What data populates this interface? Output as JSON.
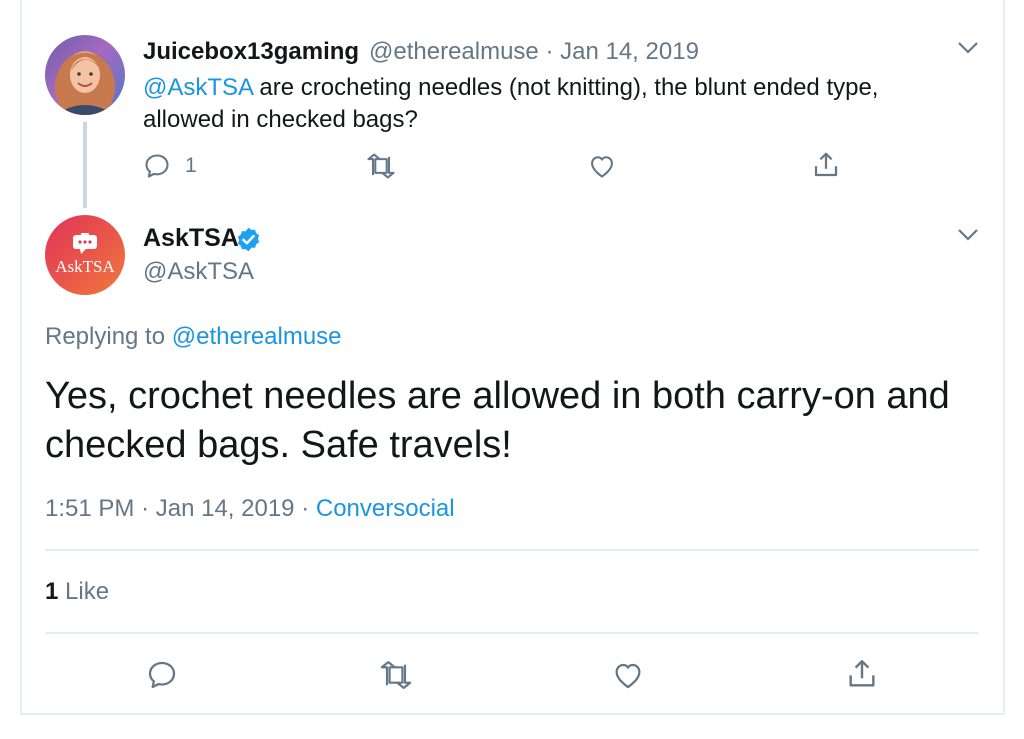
{
  "parent_tweet": {
    "display_name": "Juicebox13gaming",
    "handle": "@etherealmuse",
    "date": "Jan 14, 2019",
    "mention": "@AskTSA",
    "text_line1_rest": " are crocheting needles (not knitting), the blunt ended type,",
    "text_line2": "allowed in checked bags?",
    "reply_count": "1"
  },
  "reply_tweet": {
    "display_name": "AskTSA",
    "handle": "@AskTSA",
    "avatar_label": "AskTSA",
    "replying_to_label": "Replying to",
    "replying_to_handle": "@etherealmuse",
    "text_line1": "Yes, crochet needles are allowed in both carry-on and",
    "text_line2": "checked bags. Safe travels!",
    "time": "1:51 PM",
    "date": "Jan 14, 2019",
    "source": "Conversocial",
    "like_count": "1",
    "like_label": "Like"
  },
  "colors": {
    "link": "#1b95e0",
    "secondary_text": "#657786",
    "primary_text": "#14171a",
    "divider": "#e6ecf0",
    "verified_badge": "#1da1f2"
  },
  "icons": [
    "reply-icon",
    "retweet-icon",
    "like-icon",
    "share-icon",
    "chevron-down-icon",
    "verified-badge-icon",
    "chat-bubble-icon"
  ]
}
